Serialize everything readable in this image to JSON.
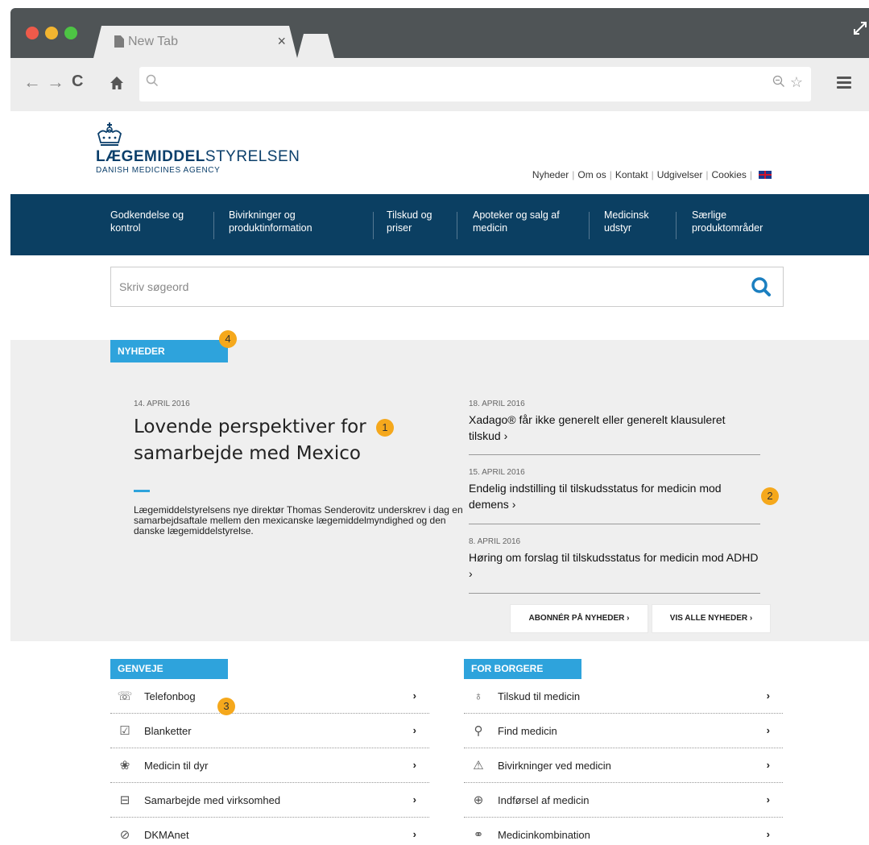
{
  "browser": {
    "tab_title": "New Tab",
    "tab_close": "×",
    "back": "←",
    "forward": "→",
    "reload": "C",
    "home": "⌂",
    "url_search_icon": "🔍",
    "zoom_icon": "⊖",
    "star_icon": "☆",
    "expand_icon": "⤢"
  },
  "site": {
    "logo_bold": "LÆGEMIDDEL",
    "logo_light": "STYRELSEN",
    "logo_sub": "DANISH MEDICINES AGENCY",
    "toplinks": [
      "Nyheder",
      "Om os",
      "Kontakt",
      "Udgivelser",
      "Cookies"
    ],
    "mainnav": [
      {
        "line1": "Godkendelse og",
        "line2": "kontrol"
      },
      {
        "line1": "Bivirkninger og",
        "line2": "produktinformation"
      },
      {
        "line1": "Tilskud og",
        "line2": "priser"
      },
      {
        "line1": "Apoteker og salg af",
        "line2": "medicin"
      },
      {
        "line1": "Medicinsk",
        "line2": "udstyr"
      },
      {
        "line1": "Særlige",
        "line2": "produktområder"
      }
    ],
    "search_placeholder": "Skriv søgeord"
  },
  "news": {
    "label": "NYHEDER",
    "main": {
      "date": "14. APRIL 2016",
      "title": "Lovende perspektiver for samarbejde med Mexico",
      "text": "Lægemiddelstyrelsens nye direktør Thomas Senderovitz underskrev i dag en samarbejdsaftale mellem den mexicanske lægemiddelmyndighed og den danske lægemiddelstyrelse."
    },
    "items": [
      {
        "date": "18. APRIL 2016",
        "title": "Xadago® får ikke generelt eller generelt klausuleret tilskud ›"
      },
      {
        "date": "15. APRIL 2016",
        "title": "Endelig indstilling til tilskudsstatus for medicin mod demens ›"
      },
      {
        "date": "8. APRIL 2016",
        "title": "Høring om forslag til tilskudsstatus for medicin mod ADHD ›"
      }
    ],
    "subscribe_label": "ABONNÉR PÅ NYHEDER  ›",
    "all_label": "VIS ALLE NYHEDER  ›"
  },
  "badges": [
    "1",
    "2",
    "3",
    "4"
  ],
  "shortcuts": {
    "label": "GENVEJE",
    "items": [
      {
        "icon": "phone-icon",
        "glyph": "☏",
        "label": "Telefonbog"
      },
      {
        "icon": "checkbox-icon",
        "glyph": "☑",
        "label": "Blanketter"
      },
      {
        "icon": "paw-icon",
        "glyph": "❀",
        "label": "Medicin til dyr"
      },
      {
        "icon": "briefcase-icon",
        "glyph": "⊟",
        "label": "Samarbejde med virksomhed"
      },
      {
        "icon": "network-icon",
        "glyph": "⊘",
        "label": "DKMAnet"
      }
    ]
  },
  "citizens": {
    "label": "FOR BORGERE",
    "items": [
      {
        "icon": "piggy-bank-icon",
        "glyph": "♁",
        "label": "Tilskud til medicin"
      },
      {
        "icon": "search-icon",
        "glyph": "⚲",
        "label": "Find medicin"
      },
      {
        "icon": "warning-icon",
        "glyph": "⚠",
        "label": "Bivirkninger ved medicin"
      },
      {
        "icon": "medkit-icon",
        "glyph": "⊕",
        "label": "Indførsel af medicin"
      },
      {
        "icon": "pills-icon",
        "glyph": "⚭",
        "label": "Medicinkombination"
      }
    ]
  },
  "chevron": "›",
  "colors": {
    "nav": "#0b3f62",
    "accent": "#2ea3dc",
    "badge": "#f5a81c"
  }
}
